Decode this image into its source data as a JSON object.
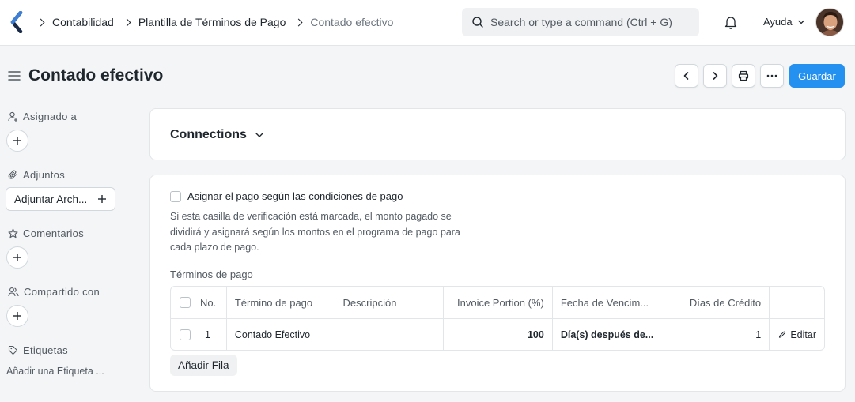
{
  "navbar": {
    "breadcrumbs": [
      "Contabilidad",
      "Plantilla de Términos de Pago",
      "Contado efectivo"
    ],
    "search_placeholder": "Search or type a command (Ctrl + G)",
    "help_label": "Ayuda"
  },
  "page": {
    "title": "Contado efectivo",
    "save_label": "Guardar"
  },
  "sidebar": {
    "assigned_label": "Asignado a",
    "attachments_label": "Adjuntos",
    "attach_button": "Adjuntar Arch...",
    "comments_label": "Comentarios",
    "shared_label": "Compartido con",
    "tags_label": "Etiquetas",
    "add_tag": "Añadir una Etiqueta ..."
  },
  "connections": {
    "title": "Connections"
  },
  "form": {
    "checkbox_label": "Asignar el pago según las condiciones de pago",
    "help_text": "Si esta casilla de verificación está marcada, el monto pagado se dividirá y asignará según los montos en el programa de pago para cada plazo de pago.",
    "table_label": "Términos de pago",
    "columns": [
      "No.",
      "Término de pago",
      "Descripción",
      "Invoice Portion (%)",
      "Fecha de Vencim...",
      "Días de Crédito"
    ],
    "rows": [
      {
        "no": "1",
        "term": "Contado Efectivo",
        "description": "",
        "portion": "100",
        "due_date": "Día(s) después de...",
        "credit_days": "1",
        "edit_label": "Editar"
      }
    ],
    "add_row_label": "Añadir Fila"
  },
  "colors": {
    "primary": "#2490ef",
    "text": "#1f272e",
    "muted": "#525a62",
    "background": "#f4f5f6",
    "border": "#e2e6e9"
  }
}
